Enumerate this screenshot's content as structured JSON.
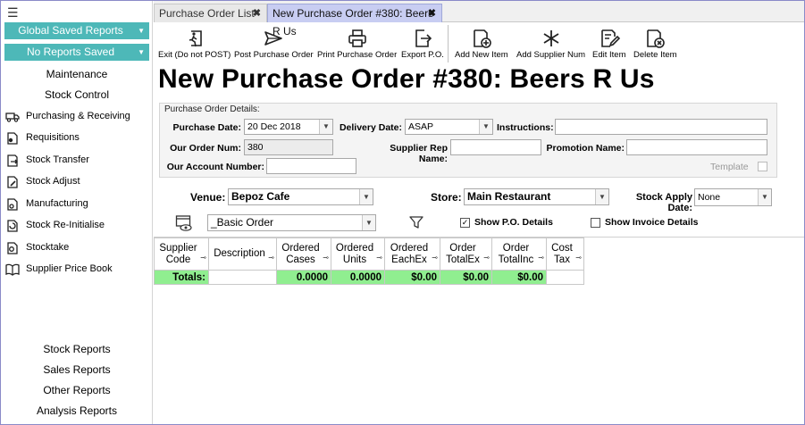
{
  "sidebar": {
    "global_saved_reports": "Global Saved Reports",
    "no_reports_saved": "No Reports Saved",
    "maintenance": "Maintenance",
    "stock_control": "Stock Control",
    "items": [
      {
        "label": "Purchasing & Receiving",
        "icon": "truck-icon"
      },
      {
        "label": "Requisitions",
        "icon": "requisition-icon"
      },
      {
        "label": "Stock Transfer",
        "icon": "transfer-icon"
      },
      {
        "label": "Stock Adjust",
        "icon": "adjust-icon"
      },
      {
        "label": "Manufacturing",
        "icon": "manufacturing-icon"
      },
      {
        "label": "Stock Re-Initialise",
        "icon": "reinitialise-icon"
      },
      {
        "label": "Stocktake",
        "icon": "stocktake-icon"
      },
      {
        "label": "Supplier Price Book",
        "icon": "book-icon"
      }
    ],
    "reports": [
      "Stock Reports",
      "Sales Reports",
      "Other Reports",
      "Analysis Reports"
    ]
  },
  "tabs": [
    {
      "label": "Purchase Order List",
      "close": "✖"
    },
    {
      "label": "New Purchase Order #380: Beers R Us",
      "close": "✖"
    }
  ],
  "toolbar": {
    "exit": "Exit (Do not POST)",
    "post": "Post Purchase Order",
    "print": "Print Purchase Order",
    "export": "Export P.O.",
    "add_item": "Add New Item",
    "add_supplier_num": "Add Supplier Num",
    "edit_item": "Edit Item",
    "delete_item": "Delete Item"
  },
  "page_title": "New Purchase Order #380: Beers R Us",
  "details": {
    "section_label": "Purchase Order Details:",
    "purchase_date_label": "Purchase Date:",
    "purchase_date": "20 Dec 2018",
    "delivery_date_label": "Delivery Date:",
    "delivery_date": "ASAP",
    "instructions_label": "Instructions:",
    "instructions": "",
    "order_num_label": "Our Order Num:",
    "order_num": "380",
    "supplier_rep_label": "Supplier Rep Name:",
    "supplier_rep": "",
    "promotion_label": "Promotion Name:",
    "promotion": "",
    "account_label": "Our Account Number:",
    "account": "",
    "template_label": "Template",
    "template_checked": false
  },
  "venue_row": {
    "venue_label": "Venue:",
    "venue": "Bepoz Cafe",
    "store_label": "Store:",
    "store": "Main Restaurant",
    "stock_apply_label": "Stock Apply Date:",
    "stock_apply": "None",
    "layout": "_Basic Order",
    "show_po_label": "Show P.O. Details",
    "show_po_checked": true,
    "show_invoice_label": "Show Invoice Details",
    "show_invoice_checked": false
  },
  "grid": {
    "columns": [
      {
        "l1": "Supplier",
        "l2": "Code"
      },
      {
        "l1": "Description",
        "l2": ""
      },
      {
        "l1": "Ordered",
        "l2": "Cases"
      },
      {
        "l1": "Ordered",
        "l2": "Units"
      },
      {
        "l1": "Ordered",
        "l2": "EachEx"
      },
      {
        "l1": "Order",
        "l2": "TotalEx"
      },
      {
        "l1": "Order",
        "l2": "TotalInc"
      },
      {
        "l1": "Cost",
        "l2": "Tax"
      }
    ],
    "totals": {
      "label": "Totals:",
      "description": "",
      "cases": "0.0000",
      "units": "0.0000",
      "each_ex": "$0.00",
      "total_ex": "$0.00",
      "total_inc": "$0.00",
      "cost_tax": ""
    }
  },
  "colors": {
    "teal": "#4db8b8",
    "active_tab": "#c8cdf2",
    "totals_green": "#90ee90"
  }
}
